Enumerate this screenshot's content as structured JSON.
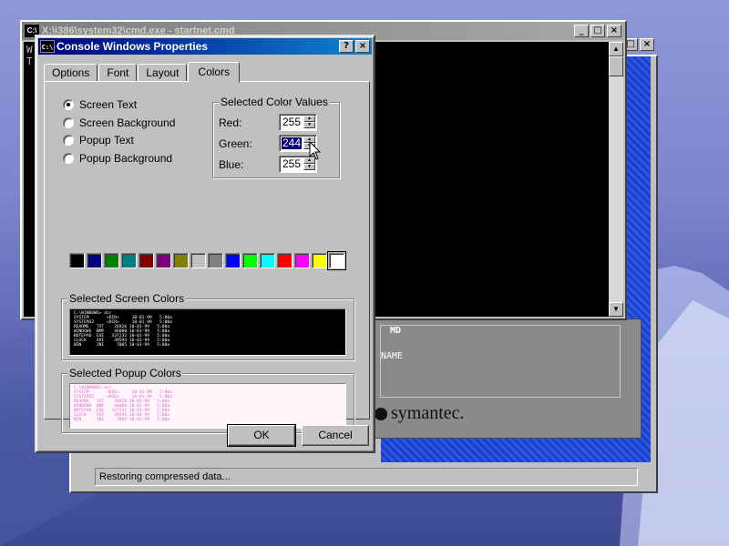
{
  "cmd_window": {
    "title": "X:\\i386\\system32\\cmd.exe - startnet.cmd",
    "sys_icon": "C:\\",
    "lines": [
      "W",
      "T"
    ],
    "buttons": {
      "minimize": "_",
      "maximize": "□",
      "close": "×"
    }
  },
  "ghost_window": {
    "title_close": "×",
    "label_md": "MD",
    "label_name": "NAME",
    "brand": "symantec.",
    "status": "Restoring compressed data..."
  },
  "dialog": {
    "title": "Console Windows Properties",
    "sys_icon": "C:\\",
    "help_btn": "?",
    "close_btn": "×",
    "tabs": [
      {
        "label": "Options",
        "active": false
      },
      {
        "label": "Font",
        "active": false
      },
      {
        "label": "Layout",
        "active": false
      },
      {
        "label": "Colors",
        "active": true
      }
    ],
    "radios": [
      {
        "label": "Screen Text",
        "checked": true
      },
      {
        "label": "Screen Background",
        "checked": false
      },
      {
        "label": "Popup Text",
        "checked": false
      },
      {
        "label": "Popup Background",
        "checked": false
      }
    ],
    "color_values": {
      "legend": "Selected Color Values",
      "red_label": "Red:",
      "red": "255",
      "green_label": "Green:",
      "green": "244",
      "blue_label": "Blue:",
      "blue": "255"
    },
    "palette": [
      "#000000",
      "#000080",
      "#008000",
      "#008080",
      "#800000",
      "#800080",
      "#808000",
      "#c0c0c0",
      "#808080",
      "#0000ff",
      "#00ff00",
      "#00ffff",
      "#ff0000",
      "#ff00ff",
      "#ffff00",
      "#ffffff"
    ],
    "selected_swatch_index": 15,
    "screen_colors": {
      "legend": "Selected Screen Colors",
      "preview": "C:\\WINDOWS> dir\nSYSTEM       <DIR>     10-01-99   5:00a\nSYSTEM32     <DIR>     10-01-99   5:00a\nREADME   TXT    26926 10-01-99   5:00a\nWINDOWS  BMP    46080 10-01-99   5:00a\nNOTEPAD  EXE   337232 10-01-99   5:00a\nCLOCK    AVI    39594 10-01-99   5:00a\nWIN      INI     7005 10-01-99   5:00a"
    },
    "popup_colors": {
      "legend": "Selected Popup Colors",
      "preview": "C:\\WINDOWS> dir\nSYSTEM       <DIR>     10-01-99   5:00a\nSYSTEM32     <DIR>     10-01-99   5:00a\nREADME   TXT    26926 10-01-99   5:00a\nWINDOWS  BMP    46080 10-01-99   5:00a\nNOTEPAD  EXE   337232 10-01-99   5:00a\nCLOCK    AVI    39594 10-01-99   5:00a\nWIN      INI     7005 10-01-99   5:00a"
    },
    "ok_label": "OK",
    "cancel_label": "Cancel"
  }
}
